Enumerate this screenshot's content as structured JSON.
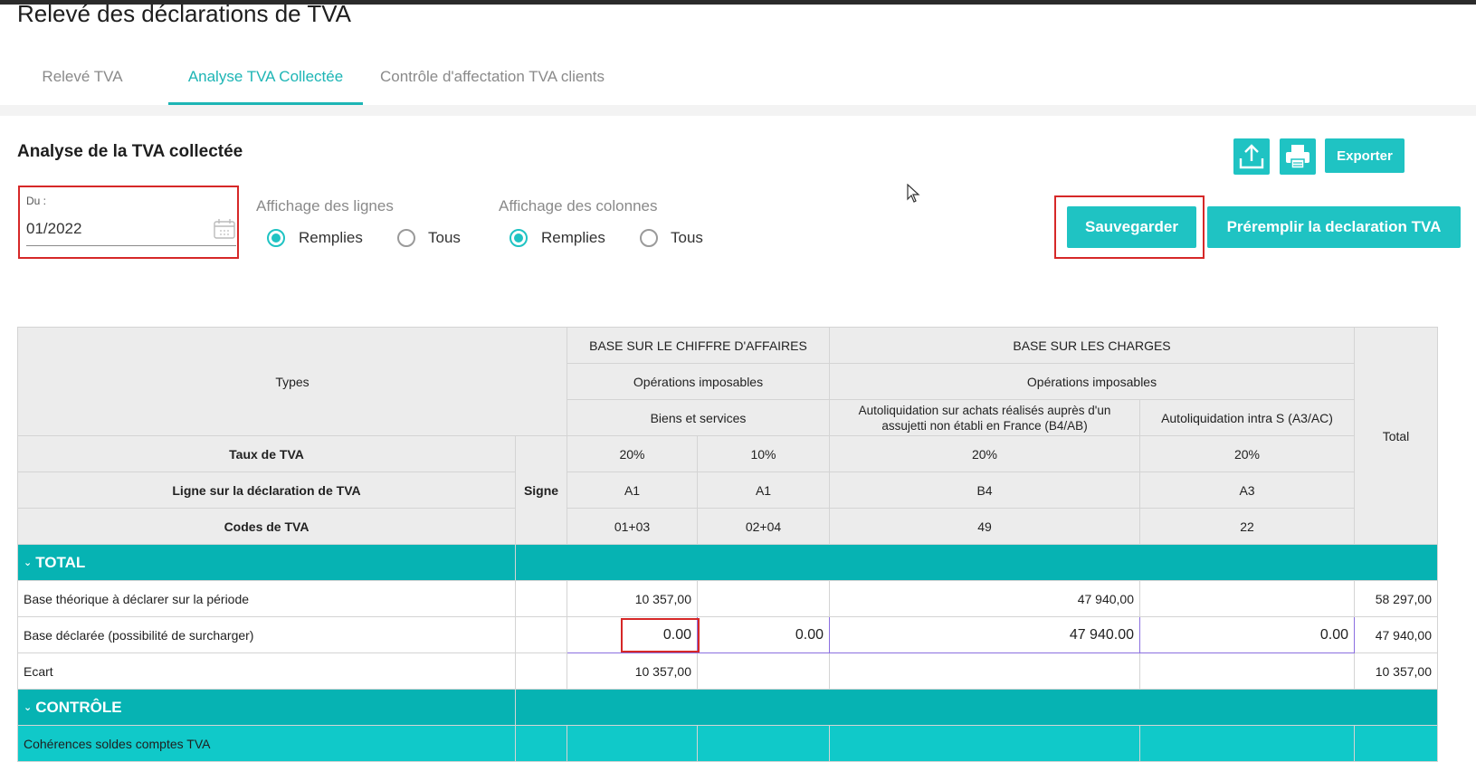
{
  "page_title": "Relevé des déclarations de TVA",
  "tabs": [
    {
      "label": "Relevé TVA",
      "active": false
    },
    {
      "label": "Analyse TVA Collectée",
      "active": true
    },
    {
      "label": "Contrôle d'affectation TVA clients",
      "active": false
    }
  ],
  "section_title": "Analyse de la TVA collectée",
  "toolbar": {
    "upload_icon": "upload-icon",
    "print_icon": "print-icon",
    "export_label": "Exporter",
    "save_label": "Sauvegarder",
    "prefill_label": "Préremplir la declaration TVA"
  },
  "filters": {
    "date_label": "Du :",
    "date_value": "01/2022",
    "lines_label": "Affichage des lignes",
    "columns_label": "Affichage des colonnes",
    "option_filled": "Remplies",
    "option_all": "Tous",
    "lines_selected": "Remplies",
    "columns_selected": "Remplies"
  },
  "table": {
    "types_label": "Types",
    "total_label": "Total",
    "signe_label": "Signe",
    "group_ca": "BASE SUR LE CHIFFRE D'AFFAIRES",
    "group_charges": "BASE SUR LES CHARGES",
    "ops_ca": "Opérations imposables",
    "ops_charges": "Opérations imposables",
    "biens_services": "Biens et services",
    "autoliq_b4": "Autoliquidation sur achats réalisés auprès d'un assujetti non établi en France (B4/AB)",
    "autoliq_a3": "Autoliquidation intra S (A3/AC)",
    "row_taux": "Taux de TVA",
    "row_ligne": "Ligne sur la déclaration de TVA",
    "row_codes": "Codes de TVA",
    "taux": [
      "20%",
      "10%",
      "20%",
      "20%"
    ],
    "lignes": [
      "A1",
      "A1",
      "B4",
      "A3"
    ],
    "codes": [
      "01+03",
      "02+04",
      "49",
      "22"
    ],
    "section_total": "TOTAL",
    "section_controle": "CONTRÔLE",
    "rows": {
      "base_theorique": {
        "label": "Base théorique à déclarer sur la période",
        "values": [
          "10 357,00",
          "",
          "47 940,00",
          ""
        ],
        "total": "58 297,00"
      },
      "base_declaree": {
        "label": "Base déclarée (possibilité de surcharger)",
        "values": [
          "0.00",
          "0.00",
          "47 940.00",
          "0.00"
        ],
        "total": "47 940,00"
      },
      "ecart": {
        "label": "Ecart",
        "values": [
          "10 357,00",
          "",
          "",
          ""
        ],
        "total": "10 357,00"
      },
      "coherences": {
        "label": "Cohérences soldes comptes TVA"
      }
    }
  }
}
